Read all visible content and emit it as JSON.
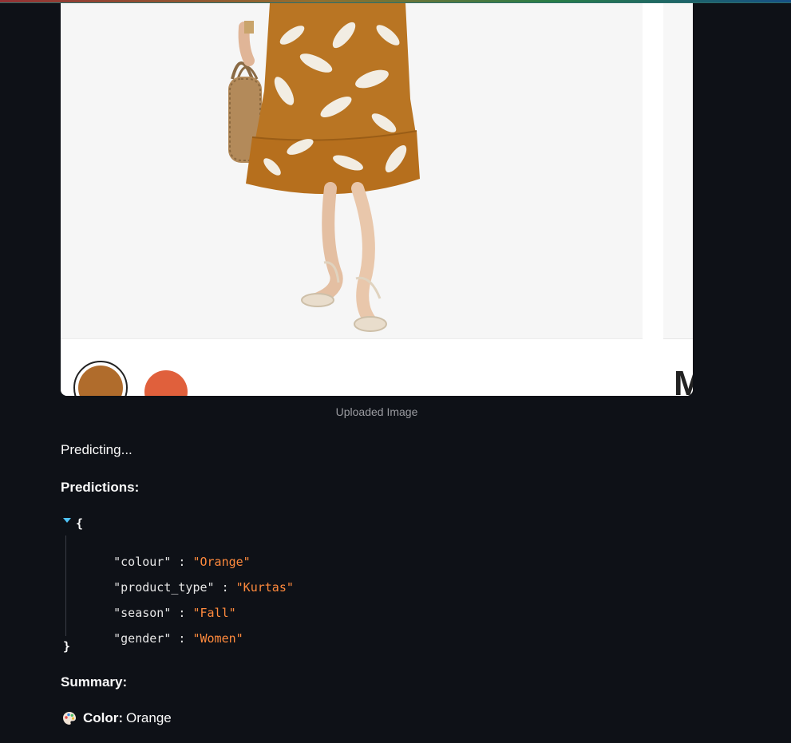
{
  "image": {
    "caption": "Uploaded Image",
    "swatches": [
      "#b06c2c",
      "#e0603c"
    ],
    "side_panel_letter": "M"
  },
  "status": {
    "predicting": "Predicting..."
  },
  "predictions": {
    "heading": "Predictions:",
    "open_brace": "{",
    "close_brace": "}",
    "entries": [
      {
        "key": "\"colour\"",
        "sep": " : ",
        "value": "\"Orange\""
      },
      {
        "key": "\"product_type\"",
        "sep": " : ",
        "value": "\"Kurtas\""
      },
      {
        "key": "\"season\"",
        "sep": " : ",
        "value": "\"Fall\""
      },
      {
        "key": "\"gender\"",
        "sep": " : ",
        "value": "\"Women\""
      }
    ]
  },
  "summary": {
    "heading": "Summary:",
    "color_icon": "palette-icon",
    "color_label": "Color:",
    "color_value": "Orange"
  },
  "colors": {
    "background": "#0e1117",
    "json_value": "#ff8a3d",
    "toggle_accent": "#4fc3f7"
  }
}
